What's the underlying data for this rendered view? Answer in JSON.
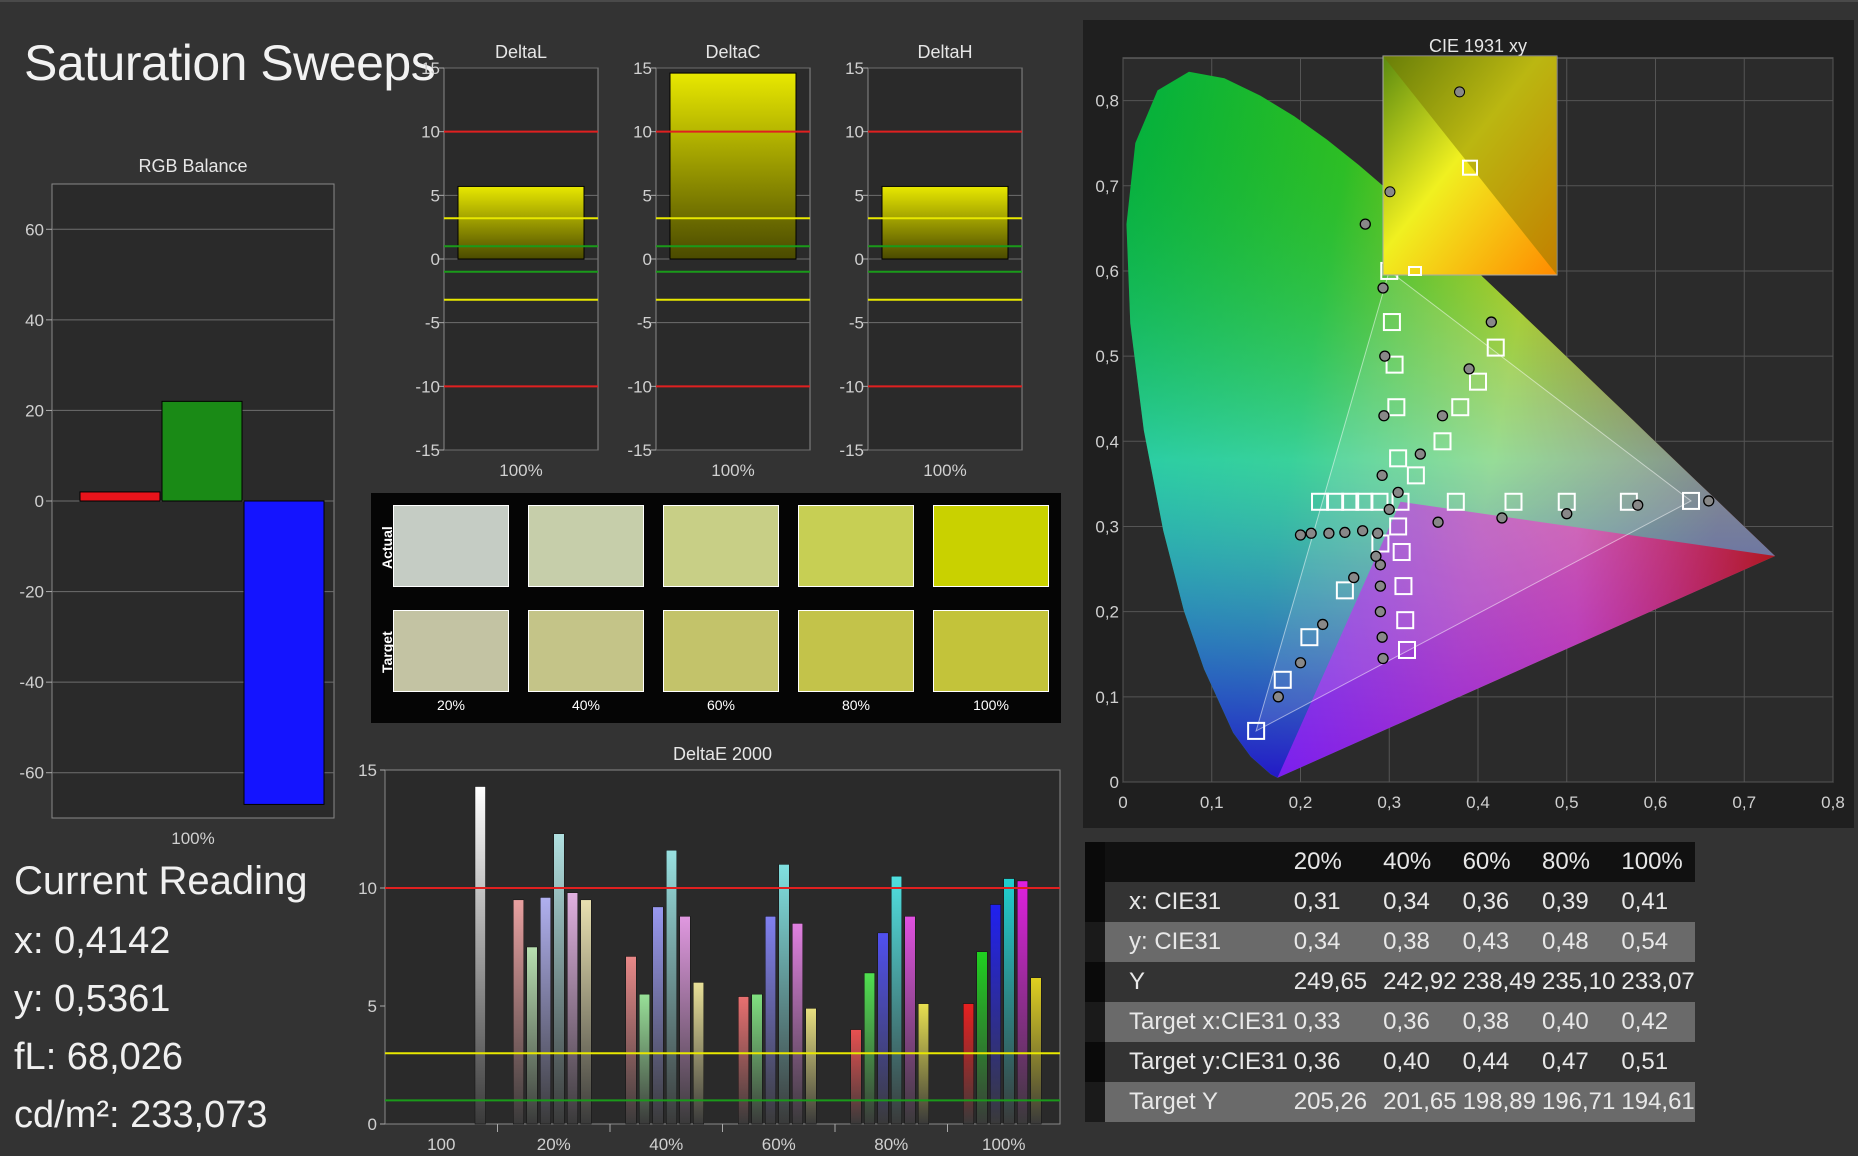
{
  "page": {
    "title": "Saturation Sweeps"
  },
  "current_reading": {
    "heading": "Current Reading",
    "x": "x: 0,4142",
    "y": "y: 0,5361",
    "fl": "fL: 68,026",
    "cdm2": "cd/m²: 233,073"
  },
  "colors": {
    "red": "#e8141b",
    "green": "#1a8a16",
    "blue": "#1414ff",
    "yellow_bar": "#d9d400",
    "ref_red": "#e02020",
    "ref_yellow": "#e8e800",
    "ref_green": "#1a9a1a",
    "panel_bg": "#2a2a2a"
  },
  "chart_data": [
    {
      "id": "rgb-balance",
      "type": "bar",
      "title": "RGB Balance",
      "categories": [
        "100%"
      ],
      "series": [
        {
          "name": "R",
          "values": [
            2
          ],
          "color": "#e8141b"
        },
        {
          "name": "G",
          "values": [
            22
          ],
          "color": "#1a8a16"
        },
        {
          "name": "B",
          "values": [
            -67
          ],
          "color": "#1414ff"
        }
      ],
      "ylim": [
        -70,
        70
      ],
      "yticks": [
        60,
        40,
        20,
        0,
        -20,
        -40,
        -60
      ],
      "grid": true
    },
    {
      "id": "delta-l",
      "type": "bar",
      "title": "DeltaL",
      "categories": [
        "100%"
      ],
      "values": [
        5.7
      ],
      "ylim": [
        -15,
        15
      ],
      "yticks": [
        15,
        10,
        5,
        0,
        -5,
        -10,
        -15
      ],
      "ref_lines": [
        10,
        3.2,
        1,
        -1,
        -3.2,
        -10
      ]
    },
    {
      "id": "delta-c",
      "type": "bar",
      "title": "DeltaC",
      "categories": [
        "100%"
      ],
      "values": [
        14.6
      ],
      "ylim": [
        -15,
        15
      ],
      "yticks": [
        15,
        10,
        5,
        0,
        -5,
        -10,
        -15
      ],
      "ref_lines": [
        10,
        3.2,
        1,
        -1,
        -3.2,
        -10
      ]
    },
    {
      "id": "delta-h",
      "type": "bar",
      "title": "DeltaH",
      "categories": [
        "100%"
      ],
      "values": [
        5.7
      ],
      "ylim": [
        -15,
        15
      ],
      "yticks": [
        15,
        10,
        5,
        0,
        -5,
        -10,
        -15
      ],
      "ref_lines": [
        10,
        3.2,
        1,
        -1,
        -3.2,
        -10
      ]
    },
    {
      "id": "delta-e-2000",
      "type": "bar",
      "title": "DeltaE 2000",
      "categories": [
        "100",
        "20%",
        "40%",
        "60%",
        "80%",
        "100%"
      ],
      "ylim": [
        0,
        15
      ],
      "yticks": [
        15,
        10,
        5,
        0
      ],
      "ref_lines": [
        10,
        3,
        1
      ],
      "groups": [
        {
          "category": "100",
          "bars": [
            {
              "value": 14.3,
              "color": "#ffffff"
            }
          ]
        },
        {
          "category": "20%",
          "bars": [
            {
              "value": 9.5,
              "color": "#e8a0a0"
            },
            {
              "value": 7.5,
              "color": "#b8e0b0"
            },
            {
              "value": 9.6,
              "color": "#b0b0f0"
            },
            {
              "value": 12.3,
              "color": "#b0e0e0"
            },
            {
              "value": 9.8,
              "color": "#e0b0e0"
            },
            {
              "value": 9.5,
              "color": "#e8e0b0"
            }
          ]
        },
        {
          "category": "40%",
          "bars": [
            {
              "value": 7.1,
              "color": "#e88888"
            },
            {
              "value": 5.5,
              "color": "#98e098"
            },
            {
              "value": 9.2,
              "color": "#9898f0"
            },
            {
              "value": 11.6,
              "color": "#98e0e0"
            },
            {
              "value": 8.8,
              "color": "#e098e0"
            },
            {
              "value": 6.0,
              "color": "#e8e098"
            }
          ]
        },
        {
          "category": "60%",
          "bars": [
            {
              "value": 5.4,
              "color": "#e87070"
            },
            {
              "value": 5.5,
              "color": "#80e080"
            },
            {
              "value": 8.8,
              "color": "#8080f0"
            },
            {
              "value": 11.0,
              "color": "#80e0e0"
            },
            {
              "value": 8.5,
              "color": "#e080e0"
            },
            {
              "value": 4.9,
              "color": "#e8e080"
            }
          ]
        },
        {
          "category": "80%",
          "bars": [
            {
              "value": 4.0,
              "color": "#e85050"
            },
            {
              "value": 6.4,
              "color": "#50e050"
            },
            {
              "value": 8.1,
              "color": "#5050f0"
            },
            {
              "value": 10.5,
              "color": "#50e0e0"
            },
            {
              "value": 8.8,
              "color": "#e050e0"
            },
            {
              "value": 5.1,
              "color": "#e8e050"
            }
          ]
        },
        {
          "category": "100%",
          "bars": [
            {
              "value": 5.1,
              "color": "#e82020"
            },
            {
              "value": 7.3,
              "color": "#20d020"
            },
            {
              "value": 9.3,
              "color": "#2020f0"
            },
            {
              "value": 10.4,
              "color": "#20d0d0"
            },
            {
              "value": 10.3,
              "color": "#e020e0"
            },
            {
              "value": 6.2,
              "color": "#e0d020"
            }
          ]
        }
      ]
    },
    {
      "id": "cie-1931-xy",
      "type": "scatter",
      "title": "CIE 1931 xy",
      "xlim": [
        0,
        0.8
      ],
      "ylim": [
        0,
        0.85
      ],
      "xticks": [
        0,
        0.1,
        0.2,
        0.3,
        0.4,
        0.5,
        0.6,
        0.7,
        0.8
      ],
      "xtick_labels": [
        "0",
        "0,1",
        "0,2",
        "0,3",
        "0,4",
        "0,5",
        "0,6",
        "0,7",
        "0,8"
      ],
      "yticks": [
        0,
        0.1,
        0.2,
        0.3,
        0.4,
        0.5,
        0.6,
        0.7,
        0.8
      ],
      "ytick_labels": [
        "0",
        "0,1",
        "0,2",
        "0,3",
        "0,4",
        "0,5",
        "0,6",
        "0,7",
        "0,8"
      ],
      "gamut": {
        "red": [
          0.64,
          0.33
        ],
        "green": [
          0.3,
          0.6
        ],
        "blue": [
          0.15,
          0.06
        ]
      },
      "targets": [
        [
          0.222,
          0.329
        ],
        [
          0.239,
          0.329
        ],
        [
          0.256,
          0.329
        ],
        [
          0.272,
          0.329
        ],
        [
          0.289,
          0.329
        ],
        [
          0.3127,
          0.329
        ],
        [
          0.375,
          0.329
        ],
        [
          0.44,
          0.329
        ],
        [
          0.5,
          0.329
        ],
        [
          0.57,
          0.329
        ],
        [
          0.64,
          0.33
        ],
        [
          0.3,
          0.6
        ],
        [
          0.303,
          0.54
        ],
        [
          0.306,
          0.49
        ],
        [
          0.308,
          0.44
        ],
        [
          0.31,
          0.38
        ],
        [
          0.33,
          0.36
        ],
        [
          0.36,
          0.4
        ],
        [
          0.38,
          0.44
        ],
        [
          0.4,
          0.47
        ],
        [
          0.42,
          0.51
        ],
        [
          0.31,
          0.3
        ],
        [
          0.314,
          0.27
        ],
        [
          0.316,
          0.23
        ],
        [
          0.318,
          0.19
        ],
        [
          0.32,
          0.155
        ],
        [
          0.29,
          0.28
        ],
        [
          0.25,
          0.225
        ],
        [
          0.21,
          0.17
        ],
        [
          0.18,
          0.12
        ],
        [
          0.15,
          0.06
        ]
      ],
      "measured": [
        [
          0.273,
          0.655
        ],
        [
          0.293,
          0.58
        ],
        [
          0.295,
          0.5
        ],
        [
          0.294,
          0.43
        ],
        [
          0.292,
          0.36
        ],
        [
          0.3,
          0.32
        ],
        [
          0.31,
          0.34
        ],
        [
          0.335,
          0.385
        ],
        [
          0.36,
          0.43
        ],
        [
          0.39,
          0.485
        ],
        [
          0.415,
          0.54
        ],
        [
          0.2,
          0.29
        ],
        [
          0.212,
          0.292
        ],
        [
          0.232,
          0.292
        ],
        [
          0.25,
          0.293
        ],
        [
          0.27,
          0.295
        ],
        [
          0.287,
          0.292
        ],
        [
          0.355,
          0.305
        ],
        [
          0.427,
          0.31
        ],
        [
          0.5,
          0.315
        ],
        [
          0.58,
          0.325
        ],
        [
          0.66,
          0.33
        ],
        [
          0.29,
          0.23
        ],
        [
          0.29,
          0.2
        ],
        [
          0.292,
          0.17
        ],
        [
          0.293,
          0.145
        ],
        [
          0.29,
          0.255
        ],
        [
          0.285,
          0.265
        ],
        [
          0.26,
          0.24
        ],
        [
          0.225,
          0.185
        ],
        [
          0.2,
          0.14
        ],
        [
          0.175,
          0.1
        ]
      ],
      "inset_targets": [
        [
          0.5,
          0.85
        ]
      ],
      "inset_measured": [
        [
          0.42,
          0.9
        ],
        [
          0.02,
          0.38
        ]
      ],
      "grid": true
    }
  ],
  "swatches": {
    "row_labels": [
      "Actual",
      "Target"
    ],
    "labels": [
      "20%",
      "40%",
      "60%",
      "80%",
      "100%"
    ],
    "actual": [
      "#c5ccc4",
      "#c6ceaa",
      "#c8cf86",
      "#c7cf54",
      "#c9d100"
    ],
    "target": [
      "#c3c3a3",
      "#c4c488",
      "#c3c36a",
      "#c3c34a",
      "#c3c33a"
    ]
  },
  "table": {
    "columns": [
      "",
      "20%",
      "40%",
      "60%",
      "80%",
      "100%"
    ],
    "rows": [
      {
        "label": "x: CIE31",
        "values": [
          "0,31",
          "0,34",
          "0,36",
          "0,39",
          "0,41"
        ]
      },
      {
        "label": "y: CIE31",
        "values": [
          "0,34",
          "0,38",
          "0,43",
          "0,48",
          "0,54"
        ]
      },
      {
        "label": "Y",
        "values": [
          "249,65",
          "242,92",
          "238,49",
          "235,10",
          "233,07"
        ]
      },
      {
        "label": "Target x:CIE31",
        "values": [
          "0,33",
          "0,36",
          "0,38",
          "0,40",
          "0,42"
        ]
      },
      {
        "label": "Target y:CIE31",
        "values": [
          "0,36",
          "0,40",
          "0,44",
          "0,47",
          "0,51"
        ]
      },
      {
        "label": "Target Y",
        "values": [
          "205,26",
          "201,65",
          "198,89",
          "196,71",
          "194,61"
        ]
      }
    ]
  }
}
